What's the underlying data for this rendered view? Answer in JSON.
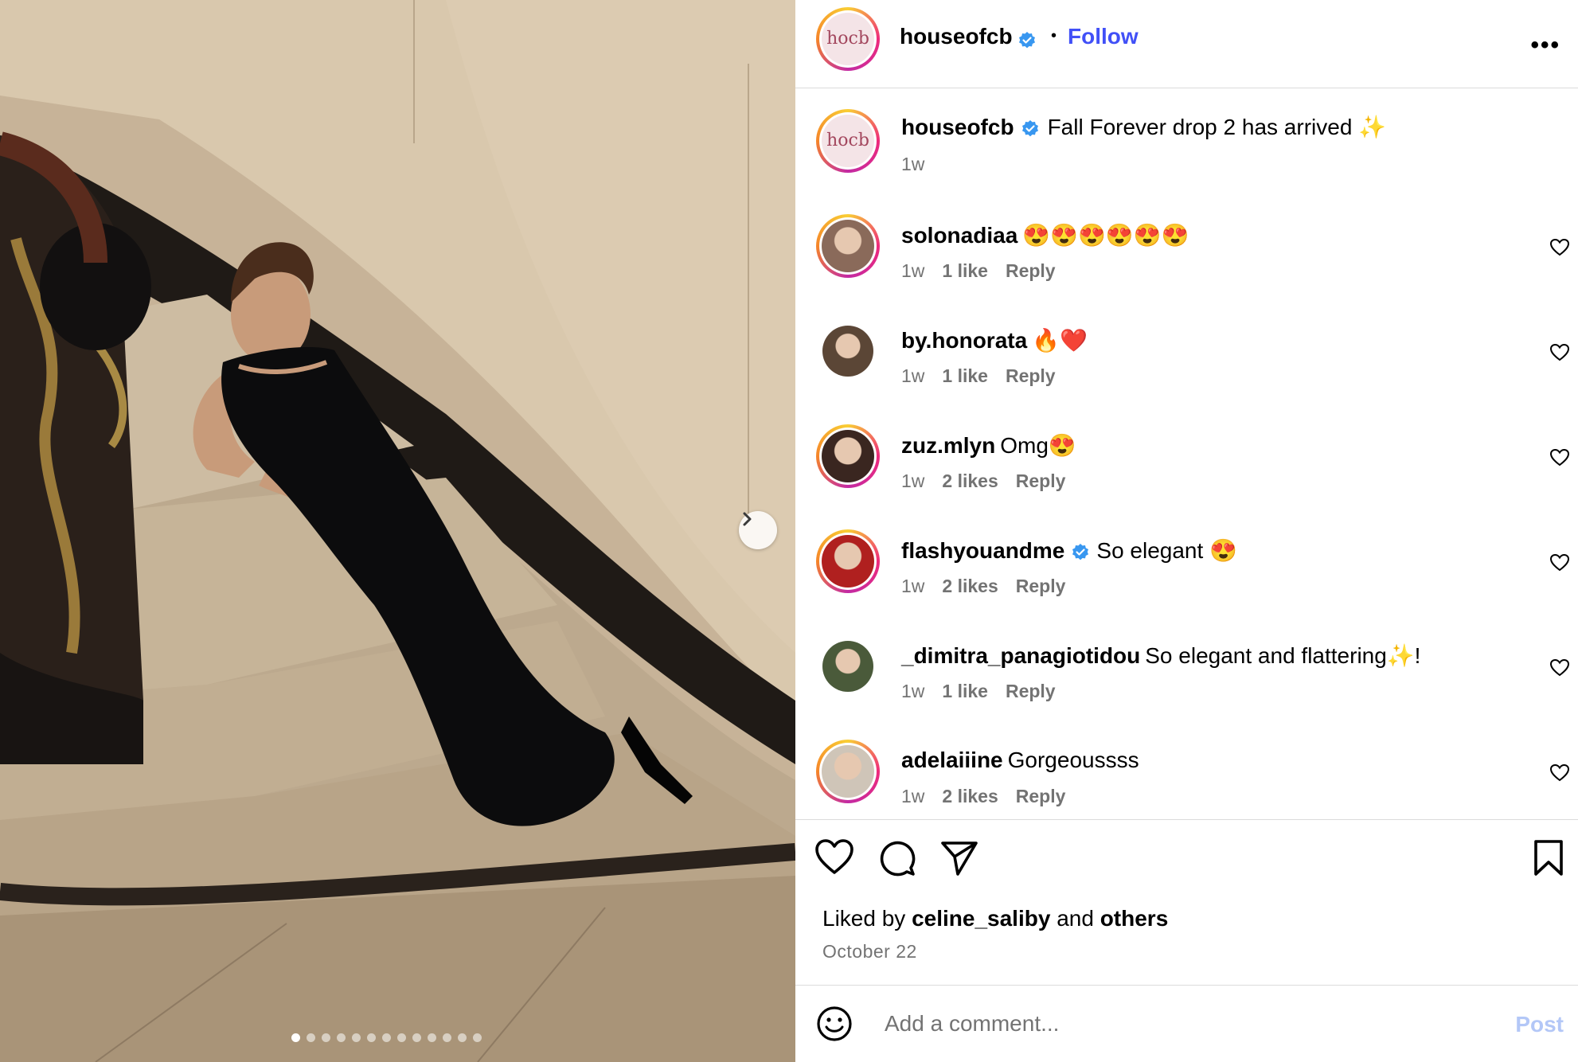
{
  "post": {
    "author": "houseofcb",
    "avatar_logo": "hocb",
    "follow_label": "Follow",
    "separator": "•",
    "more_label": "•••",
    "caption": "Fall Forever drop 2 has arrived ✨",
    "caption_time": "1w",
    "carousel": {
      "total": 13,
      "active_index": 0
    }
  },
  "comments": [
    {
      "user": "solonadiaa",
      "verified": false,
      "text": "😍😍😍😍😍😍",
      "time": "1w",
      "likes": "1 like",
      "reply": "Reply",
      "ring": true
    },
    {
      "user": "by.honorata",
      "verified": false,
      "text": "🔥❤️",
      "time": "1w",
      "likes": "1 like",
      "reply": "Reply",
      "ring": false
    },
    {
      "user": "zuz.mlyn",
      "verified": false,
      "text": "Omg😍",
      "time": "1w",
      "likes": "2 likes",
      "reply": "Reply",
      "ring": true
    },
    {
      "user": "flashyouandme",
      "verified": true,
      "text": "So elegant 😍",
      "time": "1w",
      "likes": "2 likes",
      "reply": "Reply",
      "ring": true
    },
    {
      "user": "_dimitra_panagiotidou",
      "verified": false,
      "text": "So elegant and flattering✨!",
      "time": "1w",
      "likes": "1 like",
      "reply": "Reply",
      "ring": false
    },
    {
      "user": "adelaiiine",
      "verified": false,
      "text": "Gorgeoussss",
      "time": "1w",
      "likes": "2 likes",
      "reply": "Reply",
      "ring": true
    }
  ],
  "footer": {
    "liked_prefix": "Liked by",
    "liked_user": "celine_saliby",
    "liked_and": "and",
    "liked_others": "others",
    "date": "October 22",
    "comment_placeholder": "Add a comment...",
    "post_label": "Post"
  },
  "colors": {
    "accent_blue": "#4150f7",
    "verified_blue": "#3897f0",
    "post_disabled": "#b3c7f7",
    "secondary_text": "#737373",
    "divider": "#dbdbdb"
  },
  "icons": [
    "chevron-right-icon",
    "verified-icon",
    "more-icon",
    "heart-icon",
    "comment-icon",
    "share-icon",
    "bookmark-icon",
    "emoji-icon"
  ]
}
